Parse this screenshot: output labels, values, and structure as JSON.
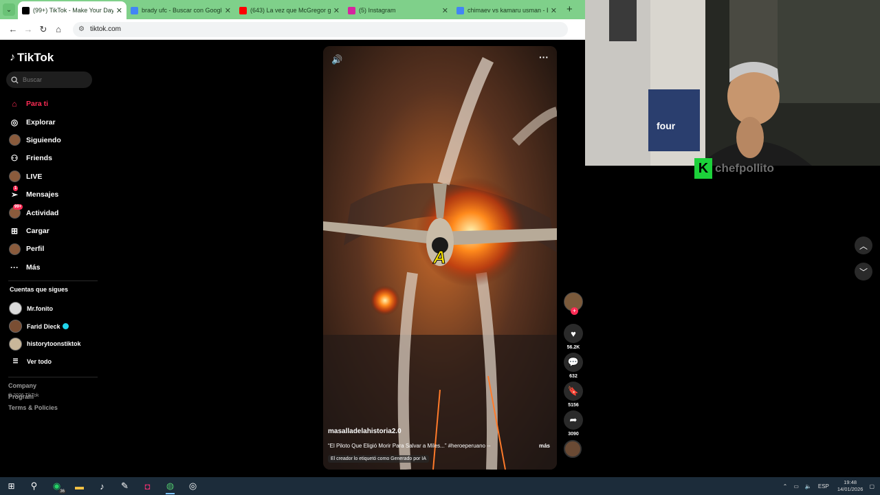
{
  "browser": {
    "tabs": [
      {
        "title": "(99+) TikTok - Make Your Day",
        "active": true,
        "favicon_color": "#000000"
      },
      {
        "title": "brady ufc - Buscar con Google",
        "active": false,
        "favicon_color": "#4285f4"
      },
      {
        "title": "(643) La vez que McGregor golpeó",
        "active": false,
        "favicon_color": "#ff0000"
      },
      {
        "title": "(5) Instagram",
        "active": false,
        "favicon_color": "#d6249f"
      },
      {
        "title": "chimaev vs kamaru usman - Bu",
        "active": false,
        "favicon_color": "#4285f4"
      }
    ],
    "new_tab": "+",
    "url": "tiktok.com"
  },
  "sidebar": {
    "logo": "TikTok",
    "search_placeholder": "Buscar",
    "nav": [
      {
        "label": "Para ti",
        "icon": "home-icon",
        "active": true
      },
      {
        "label": "Explorar",
        "icon": "compass-icon"
      },
      {
        "label": "Siguiendo",
        "icon": "following-avatar-icon"
      },
      {
        "label": "Friends",
        "icon": "friends-icon"
      },
      {
        "label": "LIVE",
        "icon": "live-icon"
      },
      {
        "label": "Mensajes",
        "icon": "messages-icon",
        "badge": "1"
      },
      {
        "label": "Actividad",
        "icon": "activity-icon",
        "badge": "99+"
      },
      {
        "label": "Cargar",
        "icon": "upload-icon"
      },
      {
        "label": "Perfil",
        "icon": "profile-icon"
      },
      {
        "label": "Más",
        "icon": "more-icon"
      }
    ],
    "following_title": "Cuentas que sigues",
    "following": [
      {
        "name": "Mr.fonito",
        "verified": false
      },
      {
        "name": "Farid Dieck",
        "verified": true
      },
      {
        "name": "historytoonstiktok",
        "verified": false
      }
    ],
    "see_all": "Ver todo",
    "footer": [
      "Company",
      "Program",
      "Terms & Policies"
    ],
    "copyright": "© 2026 TikTok"
  },
  "video": {
    "author": "masalladelahistoria2.0",
    "description": "“El Piloto Que Eligió Morir Para Salvar a Miles...” #heroeperuano --",
    "more": "más",
    "ai_label": "El creador lo etiquetó como Generado por IA",
    "subtitle": "A"
  },
  "actions": {
    "likes": "56.2K",
    "comments": "632",
    "saves": "5156",
    "shares": "3090"
  },
  "webcam": {
    "streamer": "chefpollito",
    "sign": "four"
  },
  "taskbar": {
    "whatsapp_badge": "36",
    "lang": "ESP",
    "time": "19:48",
    "date": "14/01/2026"
  }
}
